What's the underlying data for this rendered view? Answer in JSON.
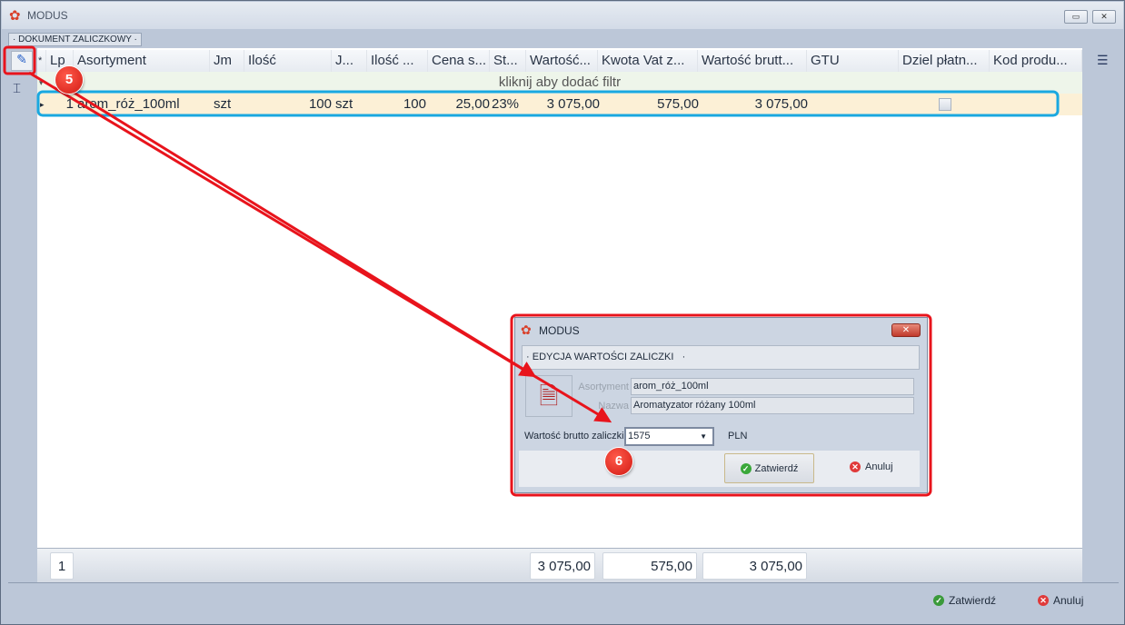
{
  "window": {
    "title": "MODUS"
  },
  "tab": {
    "label": "DOKUMENT ZALICZKOWY"
  },
  "grid": {
    "columns": [
      "*",
      "Lp",
      "Asortyment",
      "Jm",
      "Ilość",
      "J...",
      "Ilość ...",
      "Cena s...",
      "St...",
      "Wartość...",
      "Kwota Vat z...",
      "Wartość brutt...",
      "GTU",
      "Dziel płatn...",
      "Kod produ..."
    ],
    "filter_hint": "kliknij aby dodać filtr",
    "rows": [
      {
        "lp": "1",
        "asortyment": "arom_róż_100ml",
        "jm": "szt",
        "ilosc": "100",
        "j": "szt",
        "ilosc2": "100",
        "cena": "25,00",
        "stawka": "23%",
        "wartosc": "3 075,00",
        "vat": "575,00",
        "brutto": "3 075,00",
        "gtu": "",
        "dziel": false,
        "kod": ""
      }
    ]
  },
  "footer": {
    "count": "1",
    "wartosc": "3 075,00",
    "vat": "575,00",
    "brutto": "3 075,00"
  },
  "bottom": {
    "confirm": "Zatwierdź",
    "cancel": "Anuluj"
  },
  "dialog": {
    "title": "MODUS",
    "section": "EDYCJA WARTOŚCI ZALICZKI",
    "asortyment_label": "Asortyment",
    "asortyment": "arom_róż_100ml",
    "nazwa_label": "Nazwa",
    "nazwa": "Aromatyzator różany 100ml",
    "value_label": "Wartość brutto zaliczki",
    "value": "1575",
    "currency": "PLN",
    "confirm": "Zatwierdź",
    "cancel": "Anuluj"
  },
  "annotations": {
    "step1": "5",
    "step2": "6",
    "highlight_red": "#e8141c",
    "highlight_blue": "#1aa8e0"
  }
}
